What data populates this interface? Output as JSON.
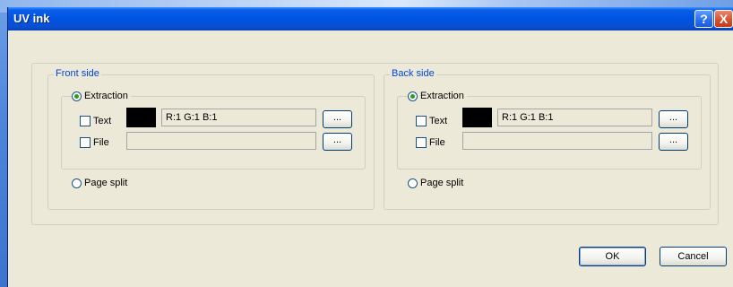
{
  "window": {
    "title": "UV ink",
    "help_label": "?",
    "close_label": "X"
  },
  "front": {
    "legend": "Front side",
    "extraction_label": "Extraction",
    "text_label": "Text",
    "color_value": "R:1 G:1 B:1",
    "file_label": "File",
    "file_value": "",
    "browse_label": "...",
    "page_split_label": "Page split",
    "extraction_selected": true,
    "text_checked": false,
    "file_checked": false,
    "swatch_color": "#000000"
  },
  "back": {
    "legend": "Back side",
    "extraction_label": "Extraction",
    "text_label": "Text",
    "color_value": "R:1 G:1 B:1",
    "file_label": "File",
    "file_value": "",
    "browse_label": "...",
    "page_split_label": "Page split",
    "extraction_selected": true,
    "text_checked": false,
    "file_checked": false,
    "swatch_color": "#000000"
  },
  "footer": {
    "ok_label": "OK",
    "cancel_label": "Cancel"
  }
}
